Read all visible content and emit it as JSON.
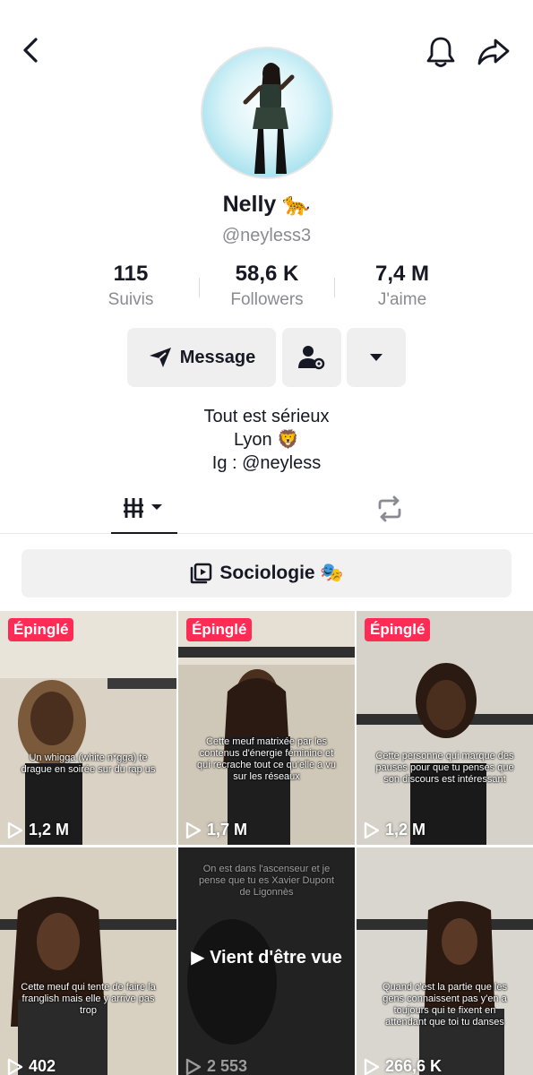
{
  "header": {
    "back_icon": "chevron-left-icon",
    "bell_icon": "bell-icon",
    "share_icon": "share-arrow-icon"
  },
  "profile": {
    "name": "Nelly 🐆",
    "handle": "@neyless3",
    "stats": [
      {
        "value": "115",
        "label": "Suivis"
      },
      {
        "value": "58,6 K",
        "label": "Followers"
      },
      {
        "value": "7,4 M",
        "label": "J'aime"
      }
    ],
    "buttons": {
      "message_label": "Message",
      "add_friend_icon": "user-gear-icon",
      "more_icon": "caret-down-icon"
    },
    "bio": [
      "Tout est sérieux",
      "Lyon 🦁",
      "Ig : @neyless"
    ]
  },
  "tabs": {
    "videos_icon": "grid-bars-icon",
    "reposts_icon": "repost-icon"
  },
  "playlist": {
    "label": "Sociologie 🎭"
  },
  "videos": [
    {
      "pinned": "Épinglé",
      "views": "1,2 M",
      "caption": "Un whigga (white n*gga) te drague en soirée sur du rap us",
      "bg": "#d9d2c5"
    },
    {
      "pinned": "Épinglé",
      "views": "1,7 M",
      "caption": "Cette meuf matrixée par les contenus d'énergie féminine et qui recrache tout ce qu'elle a vu sur les réseaux",
      "bg": "#cfc7b8"
    },
    {
      "pinned": "Épinglé",
      "views": "1,2 M",
      "caption": "Cette personne qui marque des pauses pour que tu penses que son discours est intéressant",
      "bg": "#d6d2c9"
    },
    {
      "pinned": "",
      "views": "402",
      "caption": "Cette meuf qui tente de faire la franglish mais elle y arrive pas trop",
      "bg": "#d8d1c2"
    },
    {
      "pinned": "",
      "views": "2 553",
      "caption": "On est dans l'ascenseur et je pense que tu es Xavier Dupont de Ligonnès",
      "watched": "Vient d'être vue",
      "bg": "#2e2e2e"
    },
    {
      "pinned": "",
      "views": "266,6 K",
      "caption": "Quand c'est la partie que les gens connaissent pas y'en a toujours qui te fixent en attendant que toi tu danses",
      "bg": "#d9d5cf"
    }
  ],
  "colors": {
    "pinned_badge": "#fe2c55",
    "button_bg": "#efeff0",
    "muted_text": "#8a8b91"
  }
}
